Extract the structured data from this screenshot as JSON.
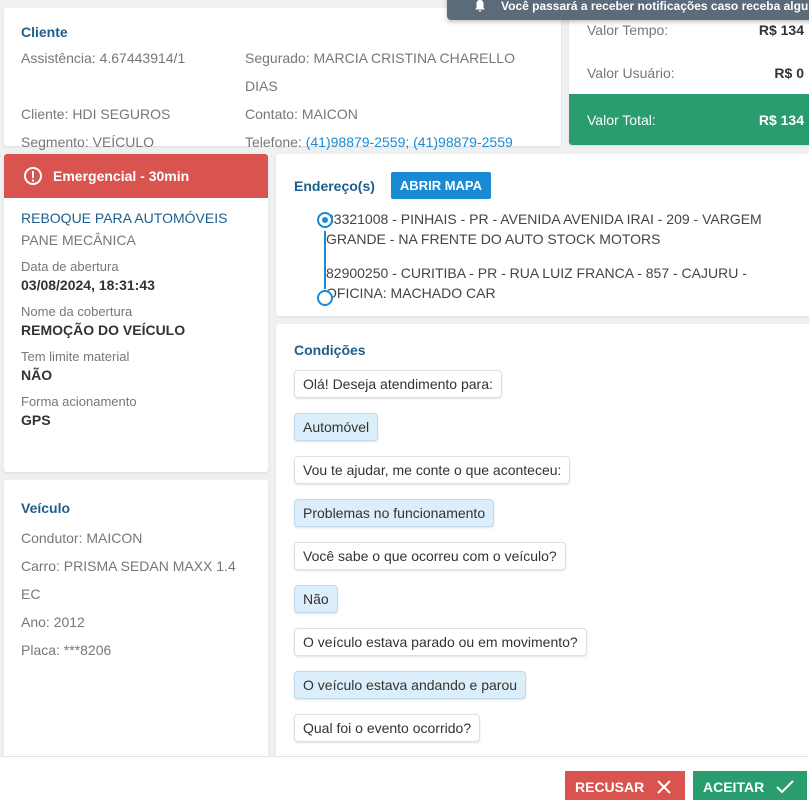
{
  "toast": {
    "text": "Você passará a receber notificações caso receba algu"
  },
  "client": {
    "title": "Cliente",
    "assistencia": "Assistência: 4.67443914/1",
    "segurado": "Segurado: MARCIA CRISTINA CHARELLO DIAS",
    "cliente": "Cliente: HDI SEGUROS",
    "contato": "Contato: MAICON",
    "segmento": "Segmento: VEÍCULO",
    "telefone_label": "Telefone: ",
    "telefone_value": "(41)98879-2559; (41)98879-2559"
  },
  "values": {
    "tempo_label": "Valor Tempo:",
    "tempo_value": "R$ 134",
    "usuario_label": "Valor Usuário:",
    "usuario_value": "R$ 0",
    "total_label": "Valor Total:",
    "total_value": "R$ 134"
  },
  "emergency": {
    "badge": "Emergencial - 30min",
    "service": "REBOQUE PARA AUTOMÓVEIS",
    "problem": "PANE MECÂNICA",
    "fields": [
      {
        "label": "Data de abertura",
        "value": "03/08/2024, 18:31:43"
      },
      {
        "label": "Nome da cobertura",
        "value": "REMOÇÃO DO VEÍCULO"
      },
      {
        "label": "Tem limite material",
        "value": "NÃO"
      },
      {
        "label": "Forma acionamento",
        "value": "GPS"
      }
    ]
  },
  "vehicle": {
    "title": "Veículo",
    "condutor": "Condutor: MAICON",
    "carro": "Carro: PRISMA SEDAN MAXX 1.4 EC",
    "ano": "Ano: 2012",
    "placa": "Placa: ***8206"
  },
  "address": {
    "title": "Endereço(s)",
    "map_button": "ABRIR MAPA",
    "items": [
      "83321008 - PINHAIS - PR - AVENIDA AVENIDA IRAI - 209 - VARGEM GRANDE - NA FRENTE DO AUTO STOCK MOTORS",
      "82900250 - CURITIBA - PR - RUA LUIZ FRANCA - 857 - CAJURU - OFICINA: MACHADO CAR"
    ]
  },
  "conditions": {
    "title": "Condições",
    "messages": [
      {
        "text": "Olá! Deseja atendimento para:",
        "type": "question"
      },
      {
        "text": "Automóvel",
        "type": "answer"
      },
      {
        "text": "Vou te ajudar, me conte o que aconteceu:",
        "type": "question"
      },
      {
        "text": "Problemas no funcionamento",
        "type": "answer"
      },
      {
        "text": "Você sabe o que ocorreu com o veículo?",
        "type": "question"
      },
      {
        "text": "Não",
        "type": "answer"
      },
      {
        "text": "O veículo estava parado ou em movimento?",
        "type": "question"
      },
      {
        "text": "O veículo estava andando e parou",
        "type": "answer"
      },
      {
        "text": "Qual foi o evento ocorrido?",
        "type": "question"
      }
    ]
  },
  "footer": {
    "reject_label": "RECUSAR",
    "accept_label": "ACEITAR"
  },
  "colors": {
    "danger": "#d9534f",
    "success": "#2a9d6f",
    "primary": "#1a8ad4",
    "title": "#1d5f8c"
  },
  "icons": [
    "bell-icon",
    "info-circle-icon",
    "close-icon",
    "check-icon"
  ]
}
